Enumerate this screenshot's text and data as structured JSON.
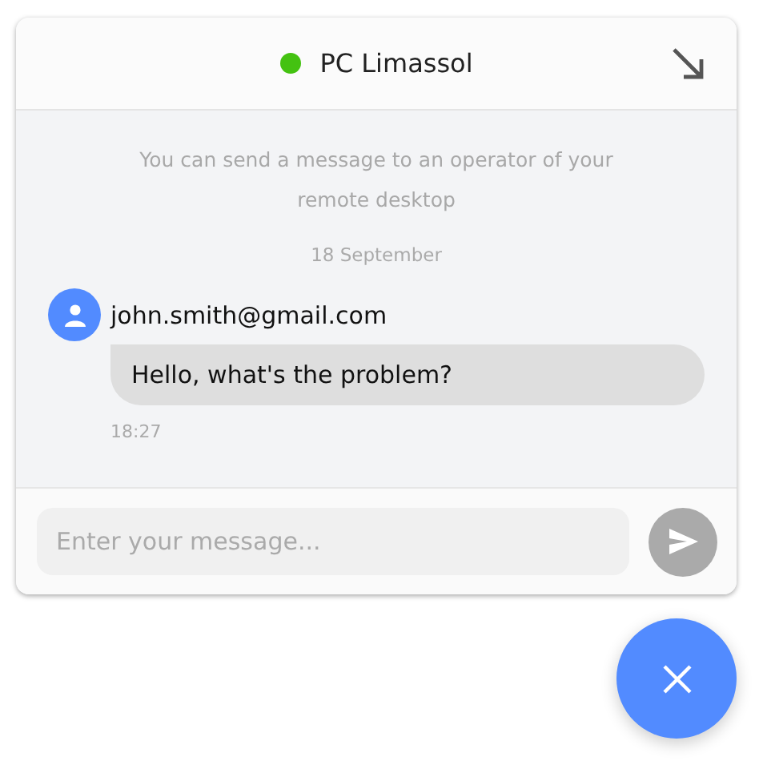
{
  "header": {
    "title": "PC Limassol",
    "online": true
  },
  "intro": "You can send a message to an operator of your remote desktop",
  "date": "18 September",
  "messages": [
    {
      "sender": "john.smith@gmail.com",
      "text": "Hello, what's the problem?",
      "time": "18:27"
    }
  ],
  "composer": {
    "placeholder": "Enter your message...",
    "send_disabled": true
  }
}
